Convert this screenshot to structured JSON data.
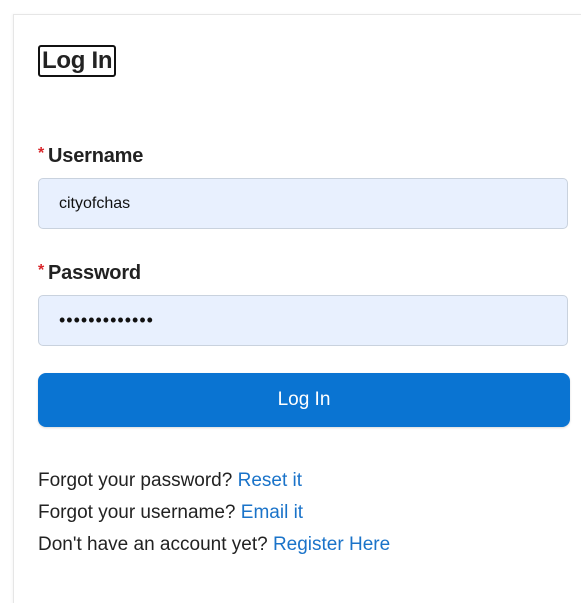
{
  "form": {
    "title": "Log In",
    "required_marker": "*",
    "username": {
      "label": "Username",
      "value": "cityofchas"
    },
    "password": {
      "label": "Password",
      "value": "•••••••••••••"
    },
    "submit_label": "Log In"
  },
  "help": {
    "forgot_password_text": "Forgot your password?",
    "forgot_password_link": "Reset it",
    "forgot_username_text": "Forgot your username?",
    "forgot_username_link": "Email it",
    "register_text": "Don't have an account yet?",
    "register_link": "Register Here"
  },
  "colors": {
    "primary_button": "#0a74d2",
    "link": "#1a73c9",
    "required": "#d9252a",
    "input_bg": "#e8f0fe"
  }
}
